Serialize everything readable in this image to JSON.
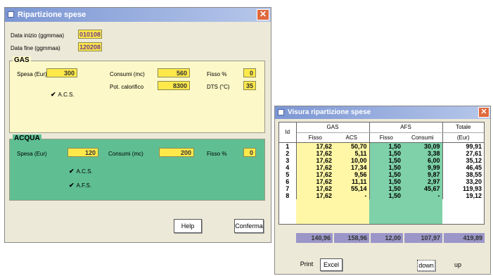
{
  "win1": {
    "title": "Ripartizione spese",
    "data_inizio_label": "Data inizio (ggmmaa)",
    "data_inizio": "010108",
    "data_fine_label": "Data fine (ggmmaa)",
    "data_fine": "120208",
    "gas": {
      "title": "GAS",
      "spesa_label": "Spesa (Eur)",
      "spesa": "300",
      "consumi_label": "Consumi (mc)",
      "consumi": "560",
      "fisso_label": "Fisso %",
      "fisso": "0",
      "potcal_label": "Pot. calorifico",
      "potcal": "8300",
      "dts_label": "DTS (°C)",
      "dts": "35",
      "acs_label": "A.C.S."
    },
    "acqua": {
      "title": "ACQUA",
      "spesa_label": "Spesa (Eur)",
      "spesa": "120",
      "consumi_label": "Consumi (mc)",
      "consumi": "200",
      "fisso_label": "Fisso %",
      "fisso": "0",
      "acs_label": "A.C.S.",
      "afs_label": "A.F.S."
    },
    "help_label": "Help",
    "conferma_label": "Conferma",
    "checkmark": "✔",
    "close_glyph": "✕"
  },
  "win2": {
    "title": "Visura ripartizione spese",
    "head_id": "Id",
    "head_gas": "GAS",
    "head_afs": "AFS",
    "head_totale": "Totale",
    "sub_fisso": "Fisso",
    "sub_acs": "ACS",
    "sub_fisso2": "Fisso",
    "sub_consumi": "Consumi",
    "sub_eur": "(Eur)",
    "rows": [
      {
        "id": "1",
        "gf": "17,62",
        "ga": "50,70",
        "af": "1,50",
        "ac": "30,09",
        "tot": "99,91"
      },
      {
        "id": "2",
        "gf": "17,62",
        "ga": "5,11",
        "af": "1,50",
        "ac": "3,38",
        "tot": "27,61"
      },
      {
        "id": "3",
        "gf": "17,62",
        "ga": "10,00",
        "af": "1,50",
        "ac": "6,00",
        "tot": "35,12"
      },
      {
        "id": "4",
        "gf": "17,62",
        "ga": "17,34",
        "af": "1,50",
        "ac": "9,99",
        "tot": "46,45"
      },
      {
        "id": "5",
        "gf": "17,62",
        "ga": "9,56",
        "af": "1,50",
        "ac": "9,87",
        "tot": "38,55"
      },
      {
        "id": "6",
        "gf": "17,62",
        "ga": "11,11",
        "af": "1,50",
        "ac": "2,97",
        "tot": "33,20"
      },
      {
        "id": "7",
        "gf": "17,62",
        "ga": "55,14",
        "af": "1,50",
        "ac": "45,67",
        "tot": "119,93"
      },
      {
        "id": "8",
        "gf": "17,62",
        "ga": "-",
        "af": "1,50",
        "ac": "-",
        "tot": "19,12"
      }
    ],
    "totals": {
      "gf": "140,96",
      "ga": "158,96",
      "af": "12,00",
      "ac": "107,97",
      "tot": "419,89"
    },
    "print_label": "Print",
    "excel_label": "Excel",
    "down_label": "down",
    "up_label": "up",
    "close_glyph": "✕"
  },
  "colors": {
    "gas_bg": "#fdf8c8",
    "acqua_bg": "#5fbf93",
    "gas_col": "#fff7a6",
    "afs_col": "#7ed1a8",
    "total_bar": "#9b96c8"
  }
}
